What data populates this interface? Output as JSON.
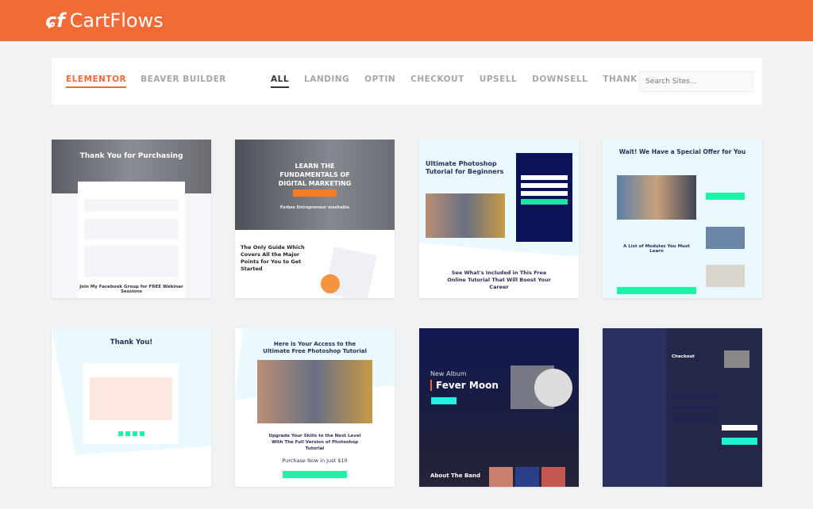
{
  "header": {
    "brand": "CartFlows",
    "logo_icon": "cf-cart-icon",
    "color": "#f26a36"
  },
  "builders": [
    {
      "label": "ELEMENTOR",
      "active": true
    },
    {
      "label": "BEAVER BUILDER",
      "active": false
    }
  ],
  "filters": [
    {
      "label": "ALL",
      "active": true
    },
    {
      "label": "LANDING"
    },
    {
      "label": "OPTIN"
    },
    {
      "label": "CHECKOUT"
    },
    {
      "label": "UPSELL"
    },
    {
      "label": "DOWNSELL"
    },
    {
      "label": "THANK YOU"
    }
  ],
  "search": {
    "placeholder": "Search Sites..."
  },
  "templates": [
    {
      "title": "Thank You for Purchasing",
      "sub": "Join My Facebook Group for FREE Webinar Sessions"
    },
    {
      "title": "LEARN THE FUNDAMENTALS OF DIGITAL MARKETING",
      "sub": "The Only Guide Which Covers All the Major Points for You to Get Started",
      "logos": "Forbes   Entrepreneur   mashable"
    },
    {
      "title": "Ultimate Photoshop Tutorial for Beginners",
      "sub": "See What's Included in This Free Online Tutorial That Will Boost Your Career"
    },
    {
      "title": "Wait! We Have a Special Offer for You",
      "sub": "A List of Modules You Must Learn"
    },
    {
      "title": "Thank You!",
      "sub": ""
    },
    {
      "title": "Here is Your Access to the Ultimate Free Photoshop Tutorial",
      "sub": "Upgrade Your Skills to the Next Level With The Full Version of Photoshop Tutorial",
      "price": "Purchase Now in Just $10"
    },
    {
      "title": "Fever Moon",
      "kicker": "New Album",
      "sub": "About The Band"
    },
    {
      "title": "Checkout",
      "sub": ""
    }
  ]
}
